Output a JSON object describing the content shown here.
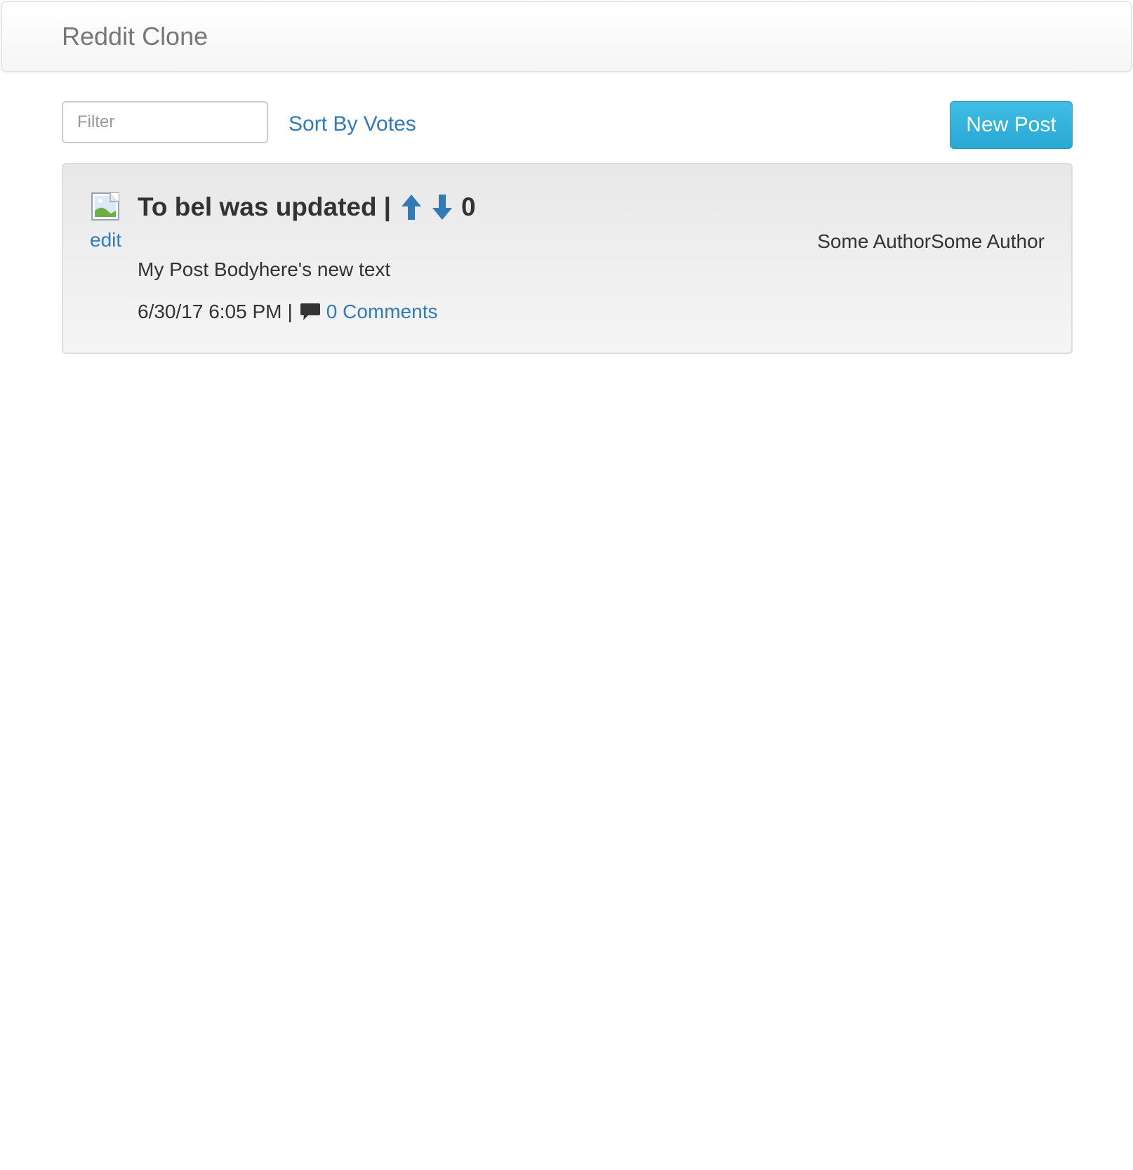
{
  "navbar": {
    "brand": "Reddit Clone"
  },
  "toolbar": {
    "filter_placeholder": "Filter",
    "filter_value": "",
    "sort_label": "Sort By Votes",
    "new_post_label": "New Post"
  },
  "posts": [
    {
      "title": "To bel was updated",
      "separator": "|",
      "votes": "0",
      "edit_label": "edit",
      "author": "Some AuthorSome Author",
      "body": "My Post Bodyhere's new text",
      "timestamp": "6/30/17 6:05 PM",
      "meta_separator": "|",
      "comments_label": "0 Comments",
      "thumbnail_icon": "broken-image-icon",
      "upvote_icon": "arrow-up-icon",
      "downvote_icon": "arrow-down-icon",
      "comment_icon": "comment-icon"
    }
  ],
  "colors": {
    "link": "#337ab7",
    "primary_button": "#31b0d5",
    "brand_text": "#777777",
    "text": "#333333"
  }
}
